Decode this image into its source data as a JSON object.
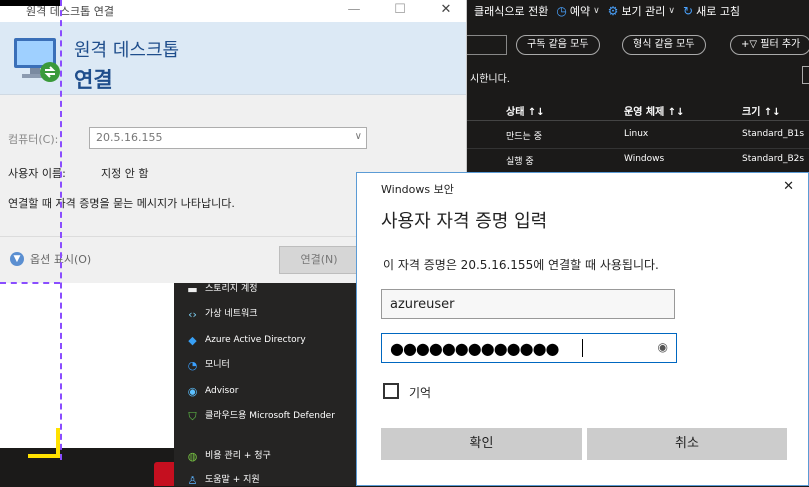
{
  "portal": {
    "topbar": [
      {
        "icon": "switch-icon",
        "glyph": "",
        "label": "클래식으로 전환"
      },
      {
        "icon": "clock-icon",
        "glyph": "◷",
        "label": "예약"
      },
      {
        "icon": "gear-icon",
        "glyph": "⚙",
        "label": "보기 관리"
      },
      {
        "icon": "refresh-icon",
        "glyph": "↻",
        "label": "새로 고침"
      }
    ],
    "filters": [
      "구독 같음 모두",
      "형식 같음 모두",
      "필터 추가"
    ],
    "message_text": "시한니다.",
    "columns": [
      "상태 ↑↓",
      "운영 체제 ↑↓",
      "크기 ↑↓"
    ],
    "rows": [
      {
        "status": "만드는 중",
        "os": "Linux",
        "size": "Standard_B1s"
      },
      {
        "status": "실행 중",
        "os": "Windows",
        "size": "Standard_B2s"
      }
    ],
    "sidemenu": [
      {
        "icon": "storage-account-icon",
        "glyph": "▬",
        "label": "스토리지 계정"
      },
      {
        "icon": "virtual-network-icon",
        "glyph": "‹›",
        "label": "가상 네트워크"
      },
      {
        "icon": "azure-ad-icon",
        "glyph": "◆",
        "label": "Azure Active Directory"
      },
      {
        "icon": "monitor-icon",
        "glyph": "◔",
        "label": "모니터"
      },
      {
        "icon": "advisor-icon",
        "glyph": "◉",
        "label": "Advisor"
      },
      {
        "icon": "defender-icon",
        "glyph": "⛉",
        "label": "클라우드용 Microsoft Defender"
      },
      {
        "icon": "cost-management-icon",
        "glyph": "◍",
        "label": "비용 관리 + 청구"
      },
      {
        "icon": "help-icon",
        "glyph": "♙",
        "label": "도움말 + 지원"
      }
    ]
  },
  "rdc": {
    "title": "원격 데스크톱 연결",
    "header_line1": "원격 데스크톱",
    "header_line2": "연결",
    "computer_label": "컴퓨터(C):",
    "computer_value": "20.5.16.155",
    "user_label": "사용자 이름:",
    "user_value": "지정 안 함",
    "info_text": "연결할 때 자격 증명을 묻는 메시지가 나타납니다.",
    "options_label": "옵션 표시(O)",
    "connect_label": "연결(N)",
    "min_glyph": "—",
    "max_glyph": "☐",
    "close_glyph": "✕"
  },
  "security": {
    "title": "Windows 보안",
    "heading": "사용자 자격 증명 입력",
    "description": "이 자격 증명은 20.5.16.155에 연결할 때 사용됩니다.",
    "username_value": "azureuser",
    "password_mask": "●●●●●●●●●●●●●",
    "remember_label": "기억",
    "ok_label": "확인",
    "cancel_label": "취소",
    "close_glyph": "✕",
    "eye_glyph": "◉"
  }
}
